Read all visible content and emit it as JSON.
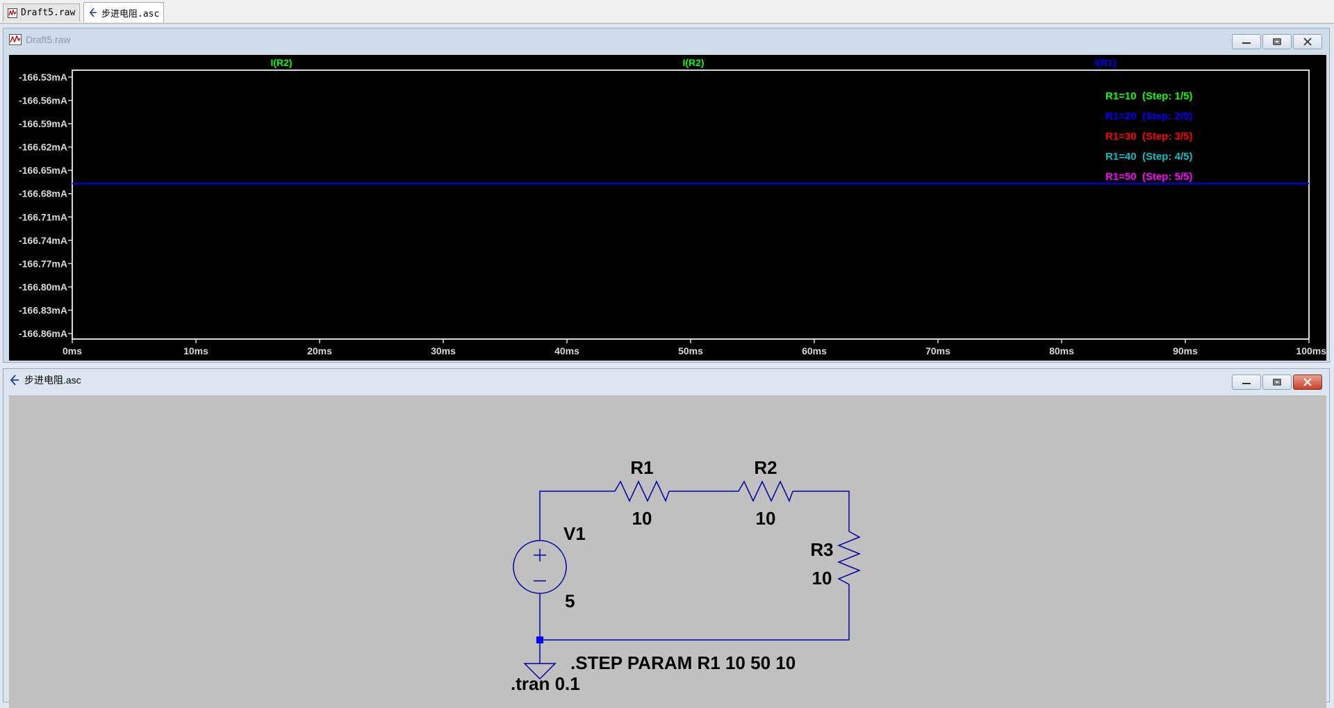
{
  "tabs": [
    {
      "label": "Draft5.raw",
      "active": false
    },
    {
      "label": "步进电阻.asc",
      "active": true
    }
  ],
  "plot_window": {
    "title": "Draft5.raw",
    "trace_labels": [
      {
        "text": "I(R2)",
        "color": "#00ff00"
      },
      {
        "text": "I(R2)",
        "color": "#00ff00"
      },
      {
        "text": "I(R1)",
        "color": "#0000ff"
      }
    ],
    "legend": [
      {
        "text": "R1=10  (Step: 1/5)",
        "color": "#00ff00"
      },
      {
        "text": "R1=20  (Step: 2/5)",
        "color": "#0000ff"
      },
      {
        "text": "R1=30  (Step: 3/5)",
        "color": "#ff0000"
      },
      {
        "text": "R1=40  (Step: 4/5)",
        "color": "#00c0c0"
      },
      {
        "text": "R1=50  (Step: 5/5)",
        "color": "#ff00ff"
      }
    ]
  },
  "chart_data": {
    "type": "line",
    "title": "",
    "xlabel": "",
    "ylabel": "",
    "x_ticks": [
      "0ms",
      "10ms",
      "20ms",
      "30ms",
      "40ms",
      "50ms",
      "60ms",
      "70ms",
      "80ms",
      "90ms",
      "100ms"
    ],
    "y_ticks": [
      "-166.53mA",
      "-166.56mA",
      "-166.59mA",
      "-166.62mA",
      "-166.65mA",
      "-166.68mA",
      "-166.71mA",
      "-166.74mA",
      "-166.77mA",
      "-166.80mA",
      "-166.83mA",
      "-166.86mA"
    ],
    "xlim": [
      0,
      100
    ],
    "ylim": [
      -166.86,
      -166.53
    ],
    "grid": false,
    "series": [
      {
        "x": [
          0,
          100
        ],
        "y": [
          -166.667,
          -166.667
        ],
        "color": "#0000ff"
      }
    ]
  },
  "schematic_window": {
    "title": "步进电阻.asc",
    "components": {
      "r1_name": "R1",
      "r1_value": "10",
      "r2_name": "R2",
      "r2_value": "10",
      "r3_name": "R3",
      "r3_value": "10",
      "v1_name": "V1",
      "v1_value": "5"
    },
    "directives": {
      "step": ".STEP PARAM R1 10 50 10",
      "tran": ".tran 0.1"
    },
    "wire_color": "#0000a0"
  }
}
